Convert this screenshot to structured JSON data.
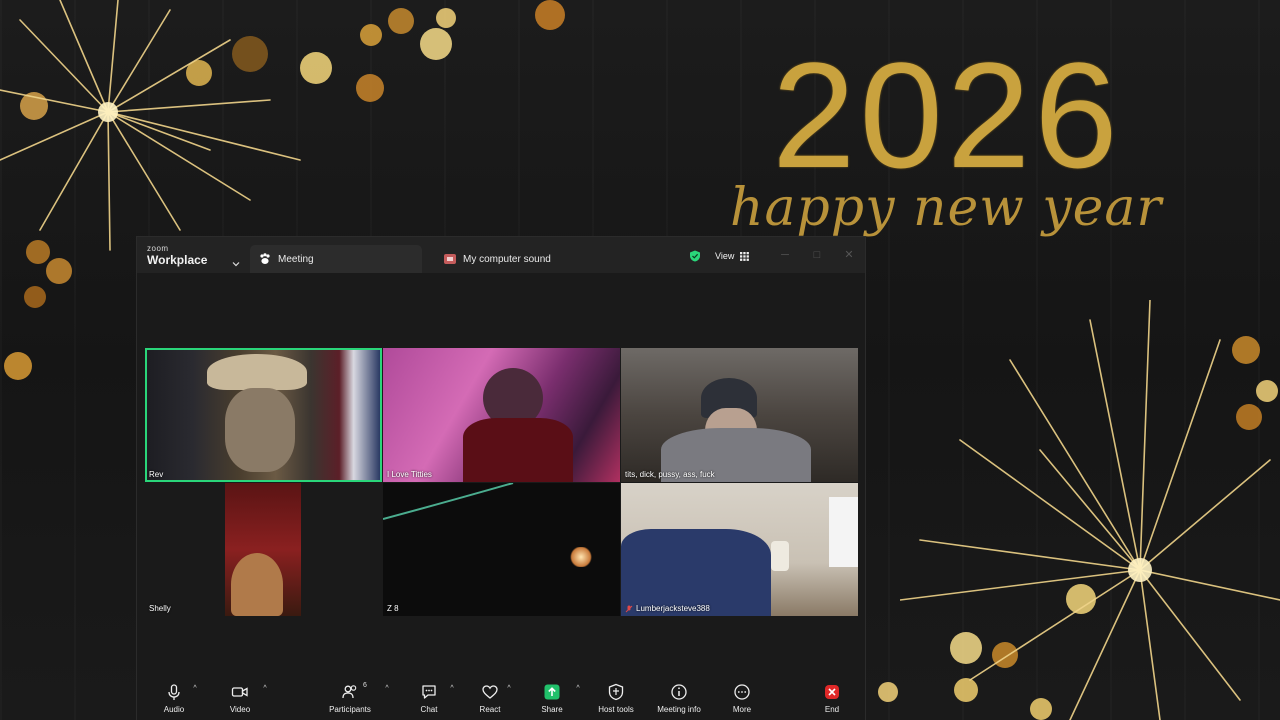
{
  "wallpaper": {
    "year": "2026",
    "tagline": "happy new year",
    "gold": "#c9a23e"
  },
  "zoom": {
    "brand_top": "zoom",
    "brand_main": "Workplace",
    "tabs": [
      {
        "label": "Meeting",
        "icon": "paw-icon"
      },
      {
        "label": "My computer sound",
        "icon": "speaker-icon"
      }
    ],
    "view_label": "View",
    "accent_green": "#2ad67a",
    "participants": [
      {
        "name": "Rev",
        "active": true
      },
      {
        "name": "I Love Titties"
      },
      {
        "name": "tits, dick, pussy, ass, fuck"
      },
      {
        "name": "Shelly"
      },
      {
        "name": "Z 8"
      },
      {
        "name": "Lumberjacksteve388",
        "muted": true
      }
    ],
    "toolbar": {
      "audio": "Audio",
      "video": "Video",
      "participants": "Participants",
      "participants_count": "6",
      "chat": "Chat",
      "react": "React",
      "share": "Share",
      "host_tools": "Host tools",
      "meeting_info": "Meeting info",
      "more": "More",
      "end": "End"
    }
  }
}
